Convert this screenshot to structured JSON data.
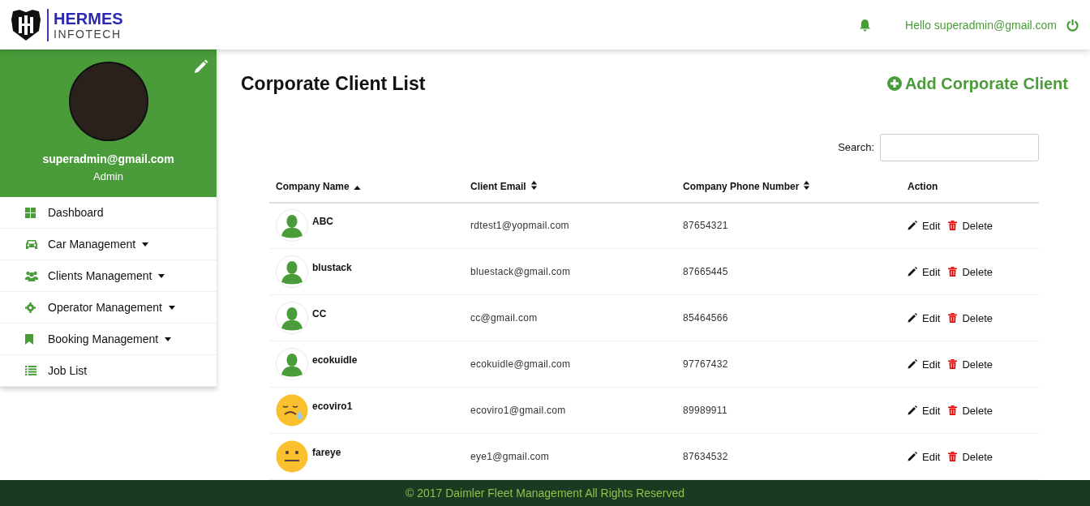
{
  "header": {
    "brand_line1": "HERMES",
    "brand_line2": "INFOTECH",
    "greeting": "Hello superadmin@gmail.com"
  },
  "profile": {
    "email": "superadmin@gmail.com",
    "role": "Admin"
  },
  "sidebar": {
    "items": [
      {
        "label": "Dashboard",
        "kind": "grid",
        "expandable": false
      },
      {
        "label": "Car Management",
        "kind": "car",
        "expandable": true
      },
      {
        "label": "Clients Management",
        "kind": "users",
        "expandable": true
      },
      {
        "label": "Operator Management",
        "kind": "gear",
        "expandable": true
      },
      {
        "label": "Booking Management",
        "kind": "bookmark",
        "expandable": true
      },
      {
        "label": "Job List",
        "kind": "list",
        "expandable": false
      }
    ]
  },
  "page": {
    "title": "Corporate Client List",
    "add_button": "Add Corporate Client"
  },
  "search": {
    "label": "Search:"
  },
  "table": {
    "columns": [
      {
        "label": "Company Name",
        "sortable": true,
        "sorted": true
      },
      {
        "label": "Client Email",
        "sortable": true,
        "sorted": false
      },
      {
        "label": "Company Phone Number",
        "sortable": true,
        "sorted": false
      },
      {
        "label": "Action",
        "sortable": false,
        "sorted": false
      }
    ],
    "rows": [
      {
        "kind": "silhouette",
        "company": "ABC",
        "email": "rdtest1@yopmail.com",
        "phone": "87654321",
        "edit": "Edit",
        "delete": "Delete"
      },
      {
        "kind": "silhouette",
        "company": "blustack",
        "email": "bluestack@gmail.com",
        "phone": "87665445",
        "edit": "Edit",
        "delete": "Delete"
      },
      {
        "kind": "silhouette",
        "company": "CC",
        "email": "cc@gmail.com",
        "phone": "85464566",
        "edit": "Edit",
        "delete": "Delete"
      },
      {
        "kind": "silhouette",
        "company": "ecokuidle",
        "email": "ecokuidle@gmail.com",
        "phone": "97767432",
        "edit": "Edit",
        "delete": "Delete"
      },
      {
        "kind": "sad-face",
        "company": "ecoviro1",
        "email": "ecoviro1@gmail.com",
        "phone": "89989911",
        "edit": "Edit",
        "delete": "Delete"
      },
      {
        "kind": "neutral-face",
        "company": "fareye",
        "email": "eye1@gmail.com",
        "phone": "87634532",
        "edit": "Edit",
        "delete": "Delete"
      }
    ]
  },
  "footer": {
    "text": "© 2017 Daimler Fleet Management All Rights Reserved"
  }
}
